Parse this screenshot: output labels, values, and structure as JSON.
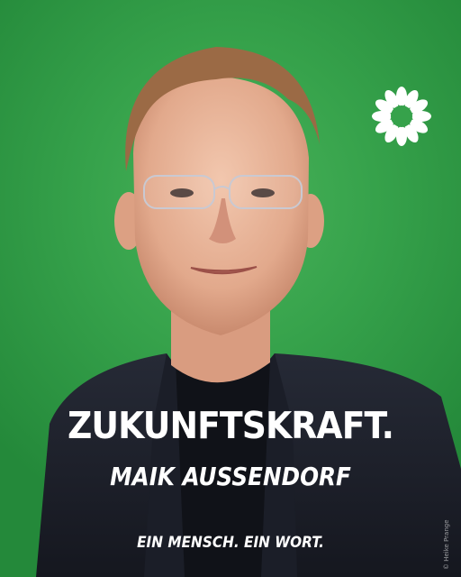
{
  "poster": {
    "headline": "ZUKUNFTSKRAFT.",
    "name": "MAIK AUSSENDORF",
    "slogan": "EIN MENSCH. EIN WORT.",
    "photo_credit": "© Heike Prange"
  },
  "colors": {
    "background": "#36a24b",
    "text": "#ffffff",
    "jacket": "#1c1f2a"
  },
  "icons": {
    "logo": "sunflower-icon"
  }
}
